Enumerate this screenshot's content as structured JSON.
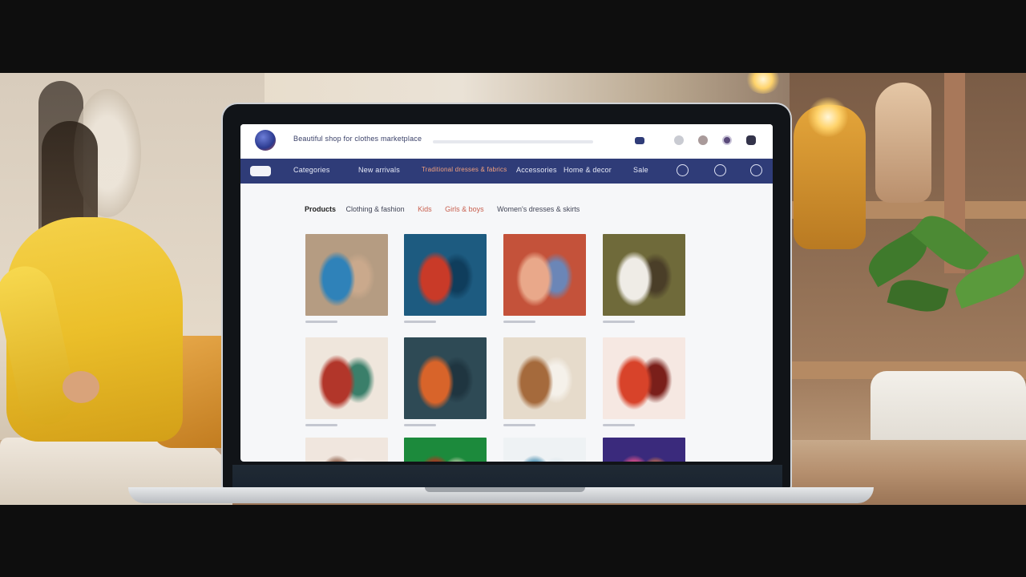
{
  "header": {
    "site_title": "Beautiful shop for clothes marketplace"
  },
  "nav": {
    "items": [
      "Categories",
      "New arrivals",
      "Traditional dresses & fabrics",
      "Accessories",
      "Home & decor",
      "Sale"
    ]
  },
  "breadcrumb": {
    "current": "Products",
    "items": [
      "Clothing & fashion",
      "Kids",
      "Girls & boys",
      "Women's dresses & skirts"
    ]
  },
  "products": [
    {
      "name": "product-blue-trousers",
      "colors": [
        "#b59c82",
        "#2f82b9",
        "#caa98c"
      ]
    },
    {
      "name": "product-red-dress",
      "colors": [
        "#1d5b80",
        "#c93a28",
        "#0f3d5c"
      ]
    },
    {
      "name": "product-multicolor-skirts",
      "colors": [
        "#c4523a",
        "#e9a88a",
        "#6b86b7"
      ]
    },
    {
      "name": "product-white-outfits",
      "colors": [
        "#6f6a3a",
        "#efece6",
        "#4a3e28"
      ]
    },
    {
      "name": "product-embroidered-robes",
      "colors": [
        "#efe6dc",
        "#b2362a",
        "#3a7f6a"
      ]
    },
    {
      "name": "product-orange-skirt",
      "colors": [
        "#2e4a55",
        "#d8642a",
        "#1f3540"
      ]
    },
    {
      "name": "product-shoes-fabric",
      "colors": [
        "#e6dbcb",
        "#a56a3c",
        "#f5f1ea"
      ]
    },
    {
      "name": "product-red-accessories",
      "colors": [
        "#f6e8e2",
        "#d8432a",
        "#7a1f1a"
      ]
    },
    {
      "name": "product-pale-item",
      "colors": [
        "#f0e6de",
        "#8a5a44",
        "#f5eeea"
      ]
    },
    {
      "name": "product-green-red-item",
      "colors": [
        "#1c8a3c",
        "#b8301e",
        "#f2e2cc"
      ]
    },
    {
      "name": "product-light-blue-item",
      "colors": [
        "#eef2f4",
        "#4a8fb0",
        "#d9e6ec"
      ]
    },
    {
      "name": "product-purple-item",
      "colors": [
        "#3a2a7c",
        "#e2508a",
        "#ff8a3a"
      ]
    }
  ],
  "colors": {
    "navbar": "#2f3c78",
    "accent": "#f2a17e",
    "shirt": "#f5d24a"
  }
}
